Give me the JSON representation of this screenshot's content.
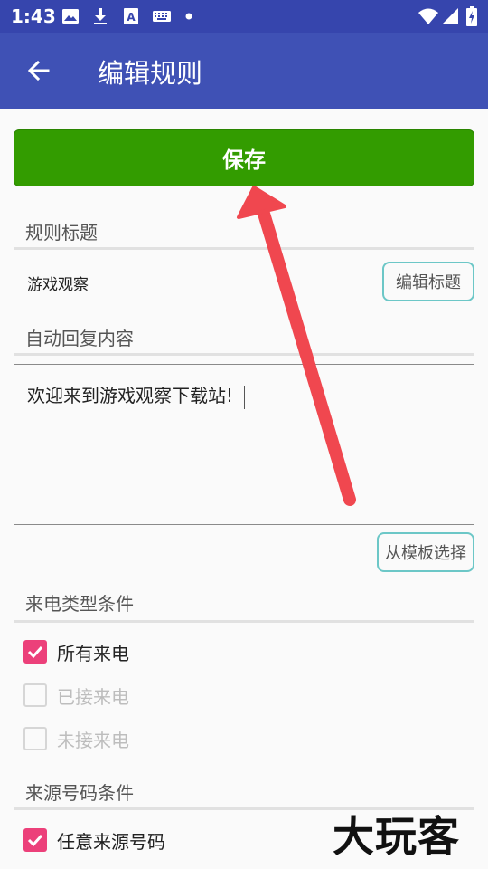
{
  "status_bar": {
    "time": "1:43",
    "left_icons": [
      "image-icon",
      "download-icon",
      "text-a-icon",
      "keyboard-icon",
      "dot-icon"
    ],
    "right_icons": [
      "wifi-icon",
      "signal-icon",
      "battery-icon"
    ]
  },
  "app_bar": {
    "title": "编辑规则",
    "back_icon": "arrow-back-icon"
  },
  "save_button": {
    "label": "保存",
    "color": "#339c00"
  },
  "rule_title_section": {
    "heading": "规则标题",
    "value": "游戏观察",
    "edit_button_label": "编辑标题"
  },
  "auto_reply_section": {
    "heading": "自动回复内容",
    "content": "欢迎来到游戏观察下载站!",
    "template_button_label": "从模板选择"
  },
  "call_type_section": {
    "heading": "来电类型条件",
    "options": [
      {
        "label": "所有来电",
        "checked": true,
        "enabled": true
      },
      {
        "label": "已接来电",
        "checked": false,
        "enabled": false
      },
      {
        "label": "未接来电",
        "checked": false,
        "enabled": false
      }
    ]
  },
  "source_number_section": {
    "heading": "来源号码条件",
    "options": [
      {
        "label": "任意来源号码",
        "checked": true,
        "enabled": true
      }
    ]
  },
  "watermark": "大玩客",
  "colors": {
    "status_bar": "#3645ad",
    "app_bar": "#3f51b5",
    "checkbox_checked": "#ec407a",
    "outline_button_border": "#6cc7c7",
    "annotation_arrow": "#f0474f"
  }
}
